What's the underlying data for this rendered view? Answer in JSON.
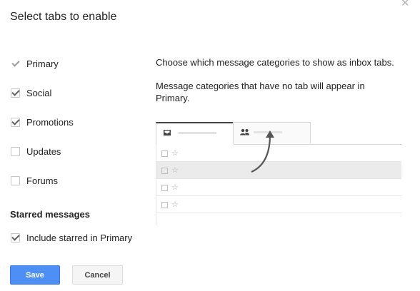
{
  "dialog": {
    "title": "Select tabs to enable",
    "close_icon": "close-icon"
  },
  "categories": [
    {
      "label": "Primary",
      "checked": true,
      "disabled": true
    },
    {
      "label": "Social",
      "checked": true,
      "disabled": false
    },
    {
      "label": "Promotions",
      "checked": true,
      "disabled": false
    },
    {
      "label": "Updates",
      "checked": false,
      "disabled": false
    },
    {
      "label": "Forums",
      "checked": false,
      "disabled": false
    }
  ],
  "starred": {
    "heading": "Starred messages",
    "option_label": "Include starred in Primary",
    "checked": true
  },
  "description": {
    "line1": "Choose which message categories to show as inbox tabs.",
    "line2": "Message categories that have no tab will appear in Primary."
  },
  "preview": {
    "tabs": [
      {
        "icon": "inbox-icon"
      },
      {
        "icon": "people-icon"
      }
    ],
    "rows": [
      {
        "shaded": false
      },
      {
        "shaded": true
      },
      {
        "shaded": false
      },
      {
        "shaded": false
      }
    ]
  },
  "buttons": {
    "save": "Save",
    "cancel": "Cancel"
  },
  "colors": {
    "primary_button": "#4d8ff5",
    "checkmark": "#5f5f5f"
  }
}
